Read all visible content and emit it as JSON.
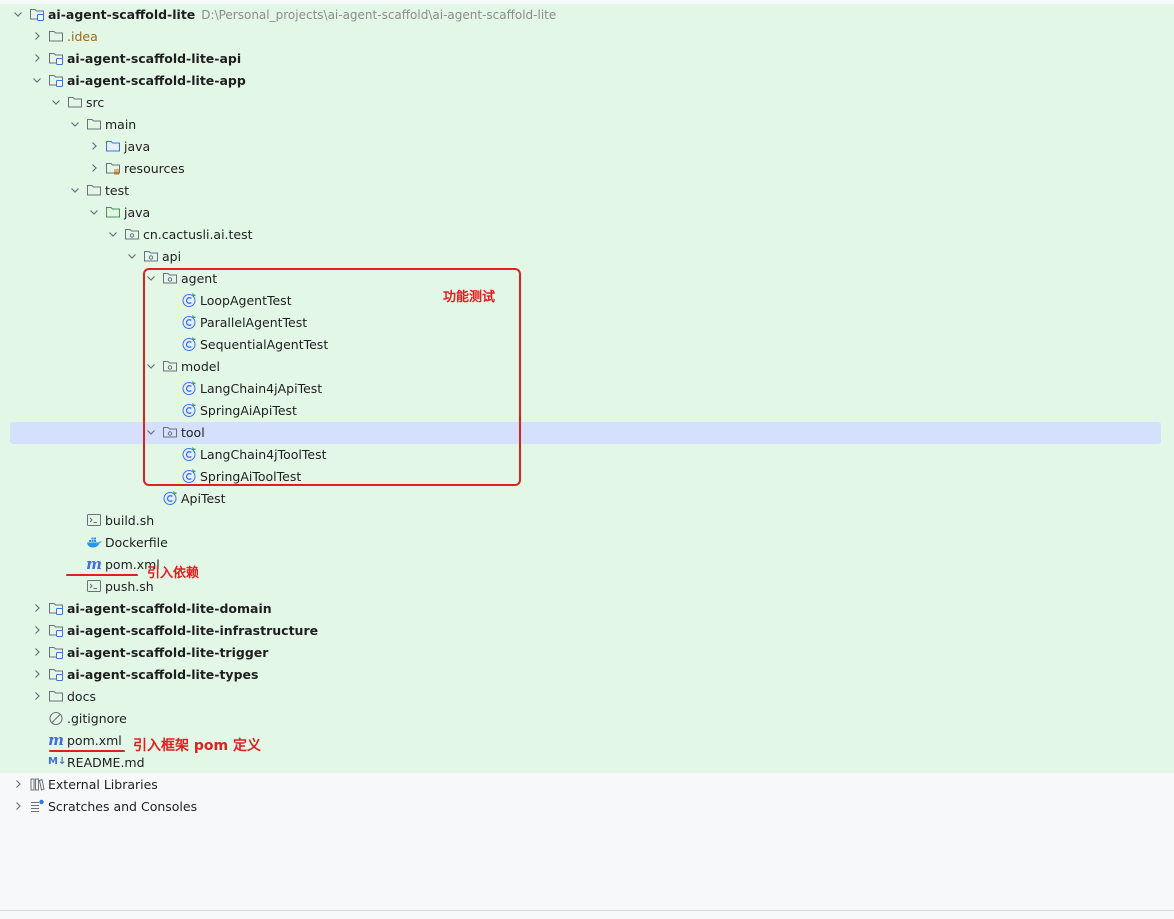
{
  "colors": {
    "project_bg": "#e3f7e7",
    "selection": "#d5e1fc",
    "annotation": "#e02020",
    "folder_icon": "#6c707e",
    "module_icon": "#3574f0"
  },
  "tree": [
    {
      "label": "ai-agent-scaffold-lite",
      "hint": "D:\\Personal_projects\\ai-agent-scaffold\\ai-agent-scaffold-lite",
      "depth": 0,
      "icon": "module-folder-icon",
      "chevron": "down",
      "bold": true
    },
    {
      "label": ".idea",
      "depth": 1,
      "icon": "folder-icon",
      "chevron": "right",
      "orange": true
    },
    {
      "label": "ai-agent-scaffold-lite-api",
      "depth": 1,
      "icon": "module-folder-icon",
      "chevron": "right",
      "bold": true
    },
    {
      "label": "ai-agent-scaffold-lite-app",
      "depth": 1,
      "icon": "module-folder-icon",
      "chevron": "down",
      "bold": true
    },
    {
      "label": "src",
      "depth": 2,
      "icon": "folder-icon",
      "chevron": "down"
    },
    {
      "label": "main",
      "depth": 3,
      "icon": "folder-icon",
      "chevron": "down"
    },
    {
      "label": "java",
      "depth": 4,
      "icon": "source-folder-icon",
      "chevron": "right"
    },
    {
      "label": "resources",
      "depth": 4,
      "icon": "resources-folder-icon",
      "chevron": "right"
    },
    {
      "label": "test",
      "depth": 3,
      "icon": "folder-icon",
      "chevron": "down"
    },
    {
      "label": "java",
      "depth": 4,
      "icon": "test-folder-icon",
      "chevron": "down"
    },
    {
      "label": "cn.cactusli.ai.test",
      "depth": 5,
      "icon": "package-icon",
      "chevron": "down"
    },
    {
      "label": "api",
      "depth": 6,
      "icon": "package-icon",
      "chevron": "down"
    },
    {
      "label": "agent",
      "depth": 7,
      "icon": "package-icon",
      "chevron": "down"
    },
    {
      "label": "LoopAgentTest",
      "depth": 8,
      "icon": "test-class-icon"
    },
    {
      "label": "ParallelAgentTest",
      "depth": 8,
      "icon": "test-class-icon"
    },
    {
      "label": "SequentialAgentTest",
      "depth": 8,
      "icon": "test-class-icon"
    },
    {
      "label": "model",
      "depth": 7,
      "icon": "package-icon",
      "chevron": "down"
    },
    {
      "label": "LangChain4jApiTest",
      "depth": 8,
      "icon": "test-class-icon"
    },
    {
      "label": "SpringAiApiTest",
      "depth": 8,
      "icon": "test-class-icon"
    },
    {
      "label": "tool",
      "depth": 7,
      "icon": "package-icon",
      "chevron": "down",
      "selected": true
    },
    {
      "label": "LangChain4jToolTest",
      "depth": 8,
      "icon": "test-class-icon"
    },
    {
      "label": "SpringAiToolTest",
      "depth": 8,
      "icon": "test-class-icon"
    },
    {
      "label": "ApiTest",
      "depth": 7,
      "icon": "test-class-icon"
    },
    {
      "label": "build.sh",
      "depth": 3,
      "icon": "shell-file-icon"
    },
    {
      "label": "Dockerfile",
      "depth": 3,
      "icon": "docker-icon"
    },
    {
      "label": "pom.xml",
      "depth": 3,
      "icon": "maven-icon"
    },
    {
      "label": "push.sh",
      "depth": 3,
      "icon": "shell-file-icon"
    },
    {
      "label": "ai-agent-scaffold-lite-domain",
      "depth": 1,
      "icon": "module-folder-icon",
      "chevron": "right",
      "bold": true
    },
    {
      "label": "ai-agent-scaffold-lite-infrastructure",
      "depth": 1,
      "icon": "module-folder-icon",
      "chevron": "right",
      "bold": true
    },
    {
      "label": "ai-agent-scaffold-lite-trigger",
      "depth": 1,
      "icon": "module-folder-icon",
      "chevron": "right",
      "bold": true
    },
    {
      "label": "ai-agent-scaffold-lite-types",
      "depth": 1,
      "icon": "module-folder-icon",
      "chevron": "right",
      "bold": true
    },
    {
      "label": "docs",
      "depth": 1,
      "icon": "folder-icon",
      "chevron": "right"
    },
    {
      "label": ".gitignore",
      "depth": 1,
      "icon": "gitignore-icon"
    },
    {
      "label": "pom.xml",
      "depth": 1,
      "icon": "maven-icon"
    },
    {
      "label": "README.md",
      "depth": 1,
      "icon": "markdown-icon"
    },
    {
      "label": "External Libraries",
      "depth": 0,
      "icon": "libraries-icon",
      "chevron": "right"
    },
    {
      "label": "Scratches and Consoles",
      "depth": 0,
      "icon": "scratches-icon",
      "chevron": "right"
    }
  ],
  "annotations": {
    "feature_test": "功能测试",
    "import_deps": "引入依赖",
    "import_framework_pom": "引入框架 pom 定义"
  }
}
